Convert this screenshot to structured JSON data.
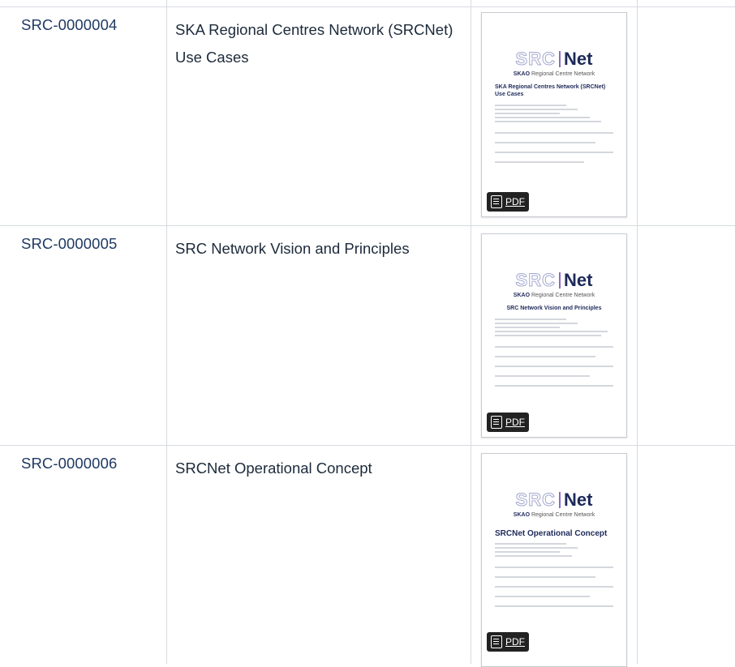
{
  "rows": [
    {
      "id": "SRC-0000004",
      "title": "SKA Regional Centres Network (SRCNet) Use Cases",
      "preview": {
        "logo_left": "SRC",
        "logo_right": "Net",
        "logo_sub_brand": "SKAO",
        "logo_sub_text": "Regional Centre Network",
        "doc_title": "SKA Regional Centres Network (SRCNet) Use Cases",
        "pdf_label": "PDF"
      }
    },
    {
      "id": "SRC-0000005",
      "title": "SRC Network Vision and Principles",
      "preview": {
        "logo_left": "SRC",
        "logo_right": "Net",
        "logo_sub_brand": "SKAO",
        "logo_sub_text": "Regional Centre Network",
        "doc_title": "SRC Network Vision and Principles",
        "pdf_label": "PDF"
      }
    },
    {
      "id": "SRC-0000006",
      "title": "SRCNet Operational Concept",
      "preview": {
        "logo_left": "SRC",
        "logo_right": "Net",
        "logo_sub_brand": "SKAO",
        "logo_sub_text": "Regional Centre Network",
        "doc_title": "SRCNet Operational Concept",
        "pdf_label": "PDF"
      }
    }
  ],
  "colors": {
    "link": "#1f3a63",
    "text": "#1c2a3a",
    "border": "#d7dbe0",
    "logo_accent": "#8e6ac4",
    "logo_dark": "#1e2a5a"
  }
}
